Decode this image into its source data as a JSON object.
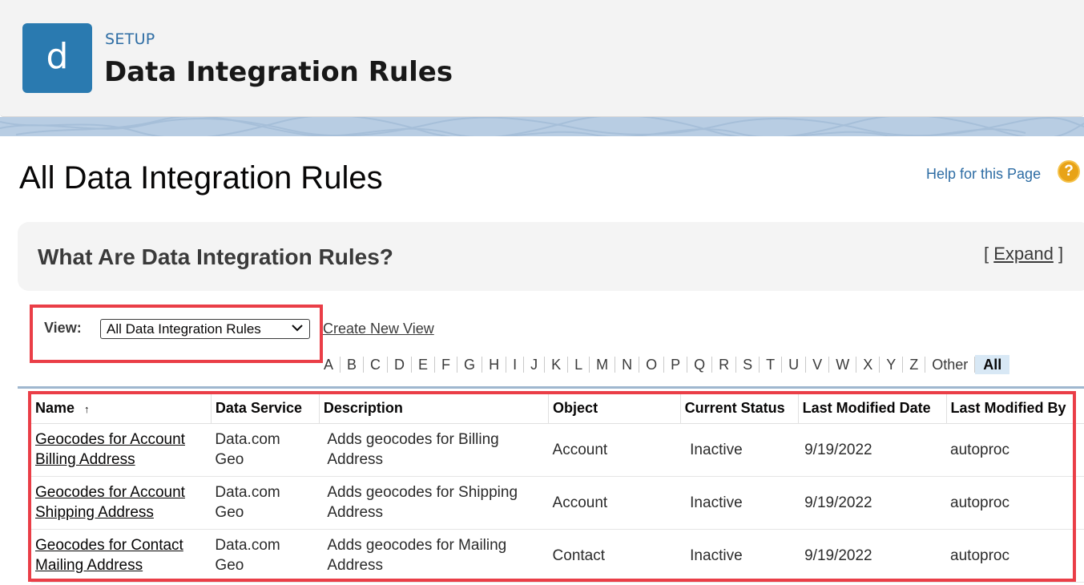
{
  "header": {
    "icon_letter": "d",
    "setup_label": "SETUP",
    "title": "Data Integration Rules"
  },
  "page": {
    "title": "All Data Integration Rules",
    "help_link": "Help for this Page",
    "help_icon": "?"
  },
  "info_box": {
    "title": "What Are Data Integration Rules?",
    "expand_open": "[ ",
    "expand_link": "Expand",
    "expand_close": " ]"
  },
  "view": {
    "label": "View:",
    "selected": "All Data Integration Rules",
    "create_link": "Create New View"
  },
  "alpha_filter": [
    "A",
    "B",
    "C",
    "D",
    "E",
    "F",
    "G",
    "H",
    "I",
    "J",
    "K",
    "L",
    "M",
    "N",
    "O",
    "P",
    "Q",
    "R",
    "S",
    "T",
    "U",
    "V",
    "W",
    "X",
    "Y",
    "Z",
    "Other",
    "All"
  ],
  "table": {
    "columns": [
      "Name",
      "Data Service",
      "Description",
      "Object",
      "Current Status",
      "Last Modified Date",
      "Last Modified By"
    ],
    "sort_indicator": "↑",
    "rows": [
      {
        "name_line1": "Geocodes for Account",
        "name_line2": "Billing Address",
        "service_line1": "Data.com",
        "service_line2": "Geo",
        "desc_line1": "Adds geocodes for Billing",
        "desc_line2": "Address",
        "object": "Account",
        "status": "Inactive",
        "date": "9/19/2022",
        "by": "autoproc"
      },
      {
        "name_line1": "Geocodes for Account",
        "name_line2": "Shipping Address",
        "service_line1": "Data.com",
        "service_line2": "Geo",
        "desc_line1": "Adds geocodes for Shipping",
        "desc_line2": "Address",
        "object": "Account",
        "status": "Inactive",
        "date": "9/19/2022",
        "by": "autoproc"
      },
      {
        "name_line1": "Geocodes for Contact",
        "name_line2": "Mailing Address",
        "service_line1": "Data.com",
        "service_line2": "Geo",
        "desc_line1": "Adds geocodes for Mailing",
        "desc_line2": "Address",
        "object": "Contact",
        "status": "Inactive",
        "date": "9/19/2022",
        "by": "autoproc"
      }
    ]
  },
  "colors": {
    "header_bg": "#f3f3f3",
    "icon_bg": "#2a7ab0",
    "link_blue": "#2e6da4",
    "highlight_red": "#ea3e47",
    "help_orange": "#e8a317",
    "band_blue": "#b8cde3"
  }
}
